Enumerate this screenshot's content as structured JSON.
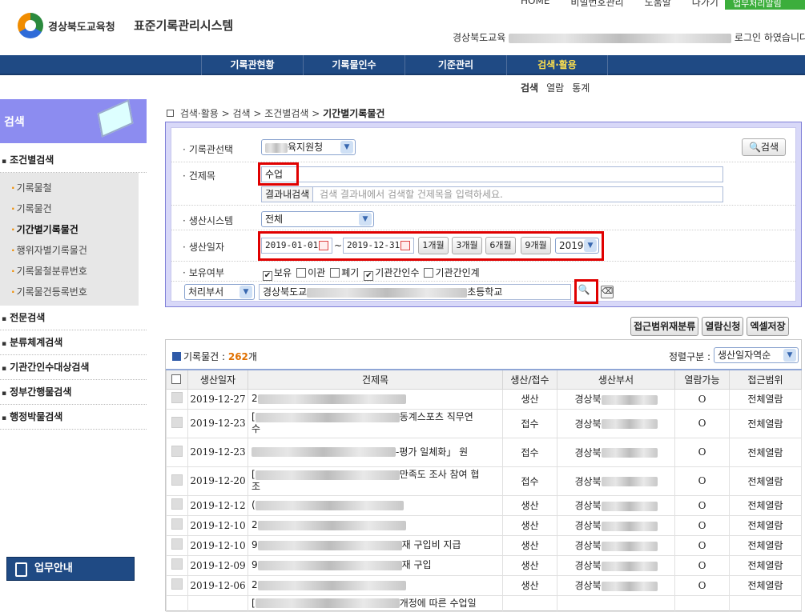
{
  "header": {
    "org_name": "경상북도교육청",
    "system_title": "표준기록관리시스템",
    "top_menu": [
      "HOME",
      "비밀번호관리",
      "도움말",
      "나가기"
    ],
    "inbox_button": "업무처리알림",
    "login_org": "경상북도교육",
    "login_suffix": "로그인 하였습니다"
  },
  "gnb": {
    "items": [
      "기록관현황",
      "기록물인수",
      "기준관리",
      "검색·활용"
    ],
    "active": "검색·활용"
  },
  "subtabs": [
    "검색",
    "열람",
    "통계"
  ],
  "sidebar": {
    "title": "검색",
    "section1": "조건별검색",
    "sub_items": [
      "기록물철",
      "기록물건",
      "기간별기록물건",
      "행위자별기록물건",
      "기록물철분류번호",
      "기록물건등록번호"
    ],
    "active_sub": "기간별기록물건",
    "sections": [
      "전문검색",
      "분류체계검색",
      "기관간인수대상검색",
      "정부간행물검색",
      "행정박물검색"
    ],
    "guide_button": "업무안내"
  },
  "breadcrumb": {
    "path": "검색·활용 > 검색 > 조건별검색 > ",
    "current": "기간별기록물건"
  },
  "search": {
    "archive_label": "기록관선택",
    "archive_value": "육지원청",
    "search_button": "검색",
    "title_label": "건제목",
    "title_value": "수업",
    "within_label": "결과내검색",
    "within_placeholder": "검색 결과내에서 검색할 건제목을 입력하세요.",
    "system_label": "생산시스템",
    "system_value": "전체",
    "date_label": "생산일자",
    "date_from": "2019-01-01",
    "date_sep": "~",
    "date_to": "2019-12-31",
    "period_buttons": [
      "1개월",
      "3개월",
      "6개월",
      "9개월"
    ],
    "year_value": "2019",
    "holding_label": "보유여부",
    "holding_options": [
      {
        "label": "보유",
        "checked": true
      },
      {
        "label": "이관",
        "checked": false
      },
      {
        "label": "폐기",
        "checked": false
      },
      {
        "label": "기관간인수",
        "checked": true
      },
      {
        "label": "기관간인계",
        "checked": false
      }
    ],
    "dept_select": "처리부서",
    "dept_prefix": "경상북도교",
    "dept_suffix": "초등학교"
  },
  "actions": [
    "접근범위재분류",
    "열람신청",
    "엑셀저장"
  ],
  "results": {
    "count_label": "기록물건 : ",
    "count": "262",
    "count_unit": "개",
    "sort_label": "정렬구분 :",
    "sort_value": "생산일자역순",
    "columns": [
      "생산일자",
      "건제목",
      "생산/접수",
      "생산부서",
      "열람가능",
      "접근범위"
    ],
    "rows": [
      {
        "date": "2019-12-27",
        "title_pre": "2",
        "title_tail": "",
        "type": "생산",
        "dept": "경상북",
        "view": "O",
        "scope": "전체열람"
      },
      {
        "date": "2019-12-23",
        "title_pre": "[",
        "title_tail": "동계스포츠 직무연",
        "title_line2": "수",
        "type": "접수",
        "dept": "경상북",
        "view": "O",
        "scope": "전체열람"
      },
      {
        "date": "2019-12-23",
        "title_pre": "",
        "title_tail": "-평가 일체화」 원",
        "title_line2": "",
        "type": "접수",
        "dept": "경상북",
        "view": "O",
        "scope": "전체열람"
      },
      {
        "date": "2019-12-20",
        "title_pre": "[",
        "title_tail": "만족도 조사 참여 협",
        "title_line2": "조",
        "type": "접수",
        "dept": "경상북",
        "view": "O",
        "scope": "전체열람"
      },
      {
        "date": "2019-12-12",
        "title_pre": "(",
        "title_tail": "",
        "type": "생산",
        "dept": "경상북",
        "view": "O",
        "scope": "전체열람"
      },
      {
        "date": "2019-12-10",
        "title_pre": "2",
        "title_tail": "",
        "type": "생산",
        "dept": "경상북",
        "view": "O",
        "scope": "전체열람"
      },
      {
        "date": "2019-12-10",
        "title_pre": "9",
        "title_tail": "재 구입비 지급",
        "type": "생산",
        "dept": "경상북",
        "view": "O",
        "scope": "전체열람"
      },
      {
        "date": "2019-12-09",
        "title_pre": "9",
        "title_tail": "재 구입",
        "type": "생산",
        "dept": "경상북",
        "view": "O",
        "scope": "전체열람"
      },
      {
        "date": "2019-12-06",
        "title_pre": "2",
        "title_tail": "",
        "type": "생산",
        "dept": "경상북",
        "view": "O",
        "scope": "전체열람"
      },
      {
        "date": "",
        "title_pre": "[",
        "title_tail": "개정에 따른 수업일",
        "type": "",
        "dept": "",
        "view": "",
        "scope": ""
      }
    ]
  }
}
